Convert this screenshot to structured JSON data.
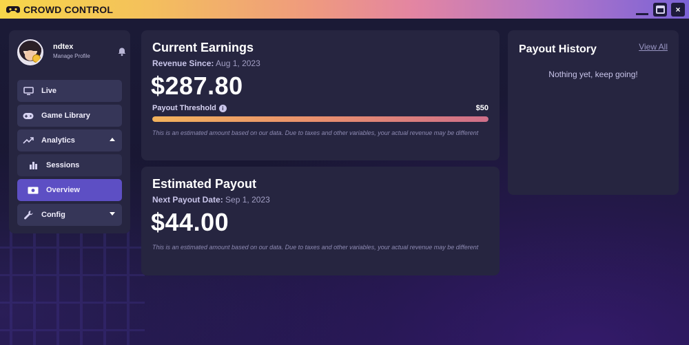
{
  "app": {
    "title": "CROWD CONTROL",
    "logo_icon": "gamepad-logo-icon"
  },
  "window_controls": {
    "minimize_icon": "minimize-icon",
    "maximize_icon": "maximize-icon",
    "close_label": "×"
  },
  "profile": {
    "name": "ndtex",
    "subtitle": "Manage Profile",
    "notification_icon": "bell-icon"
  },
  "sidebar": {
    "items": [
      {
        "label": "Live",
        "icon": "monitor-icon"
      },
      {
        "label": "Game Library",
        "icon": "gamepad-icon"
      },
      {
        "label": "Analytics",
        "icon": "trend-icon",
        "expanded": true
      },
      {
        "label": "Sessions",
        "icon": "bar-chart-icon",
        "sub": true
      },
      {
        "label": "Overview",
        "icon": "money-icon",
        "sub": true,
        "active": true
      },
      {
        "label": "Config",
        "icon": "wrench-icon",
        "expanded": false
      }
    ]
  },
  "earnings": {
    "title": "Current Earnings",
    "revenue_since_label": "Revenue Since:",
    "revenue_since_value": "Aug 1, 2023",
    "amount": "$287.80",
    "threshold_label": "Payout Threshold",
    "threshold_max": "$50",
    "threshold_progress": 1.0,
    "disclaimer": "This is an estimated amount based on our data. Due to taxes and other variables, your actual revenue may be different"
  },
  "payout": {
    "title": "Estimated Payout",
    "next_date_label": "Next Payout Date:",
    "next_date_value": "Sep 1, 2023",
    "amount": "$44.00",
    "disclaimer": "This is an estimated amount based on our data. Due to taxes and other variables, your actual revenue may be different"
  },
  "history": {
    "title": "Payout History",
    "view_all": "View All",
    "empty_text": "Nothing yet, keep going!"
  },
  "colors": {
    "accent": "#5d4fc4",
    "card_bg": "#262540",
    "page_bg": "#17152e"
  }
}
